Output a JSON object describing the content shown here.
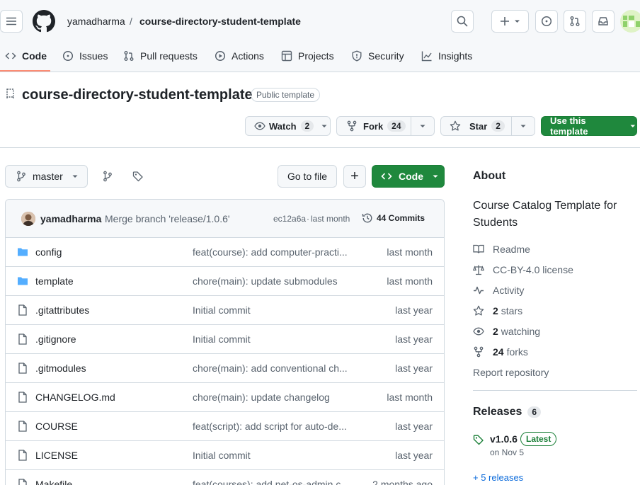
{
  "header": {
    "owner": "yamadharma",
    "separator": "/",
    "repo": "course-directory-student-template"
  },
  "nav": {
    "tabs": [
      {
        "label": "Code",
        "icon": "code-icon",
        "active": true
      },
      {
        "label": "Issues",
        "icon": "issue-icon"
      },
      {
        "label": "Pull requests",
        "icon": "pull-request-icon"
      },
      {
        "label": "Actions",
        "icon": "play-icon"
      },
      {
        "label": "Projects",
        "icon": "table-icon"
      },
      {
        "label": "Security",
        "icon": "shield-icon"
      },
      {
        "label": "Insights",
        "icon": "graph-icon"
      }
    ]
  },
  "repo": {
    "title": "course-directory-student-template",
    "visibility": "Public template",
    "watch_label": "Watch",
    "watch_count": "2",
    "fork_label": "Fork",
    "fork_count": "24",
    "star_label": "Star",
    "star_count": "2",
    "use_template_label": "Use this template"
  },
  "toolbar": {
    "branch": "master",
    "go_to_file": "Go to file",
    "add_label": "+",
    "code_label": "Code"
  },
  "commit": {
    "author": "yamadharma",
    "message": "Merge branch 'release/1.0.6'",
    "hash": "ec12a6a",
    "dot": "·",
    "time": "last month",
    "commits_label": "44 Commits"
  },
  "files": [
    {
      "name": "config",
      "type": "dir",
      "message": "feat(course): add computer-practi...",
      "date": "last month"
    },
    {
      "name": "template",
      "type": "dir",
      "message": "chore(main): update submodules",
      "date": "last month"
    },
    {
      "name": ".gitattributes",
      "type": "file",
      "message": "Initial commit",
      "date": "last year"
    },
    {
      "name": ".gitignore",
      "type": "file",
      "message": "Initial commit",
      "date": "last year"
    },
    {
      "name": ".gitmodules",
      "type": "file",
      "message": "chore(main): add conventional ch...",
      "date": "last year"
    },
    {
      "name": "CHANGELOG.md",
      "type": "file",
      "message": "chore(main): update changelog",
      "date": "last month"
    },
    {
      "name": "COURSE",
      "type": "file",
      "message": "feat(script): add script for auto-de...",
      "date": "last year"
    },
    {
      "name": "LICENSE",
      "type": "file",
      "message": "Initial commit",
      "date": "last year"
    },
    {
      "name": "Makefile",
      "type": "file",
      "message": "feat(courses): add net-os-admin c...",
      "date": "2 months ago"
    }
  ],
  "about": {
    "heading": "About",
    "description": "Course Catalog Template for Students",
    "readme": "Readme",
    "license": "CC-BY-4.0 license",
    "activity": "Activity",
    "stars_count": "2",
    "stars_label": "stars",
    "watching_count": "2",
    "watching_label": "watching",
    "forks_count": "24",
    "forks_label": "forks",
    "report": "Report repository"
  },
  "releases": {
    "heading": "Releases",
    "count": "6",
    "tag": "v1.0.6",
    "latest_badge": "Latest",
    "date": "on Nov 5",
    "more": "+ 5 releases"
  },
  "colors": {
    "accent_green": "#1f883d",
    "link_blue": "#0969da",
    "active_tab": "#fd8c73",
    "folder_blue": "#54aeff"
  }
}
